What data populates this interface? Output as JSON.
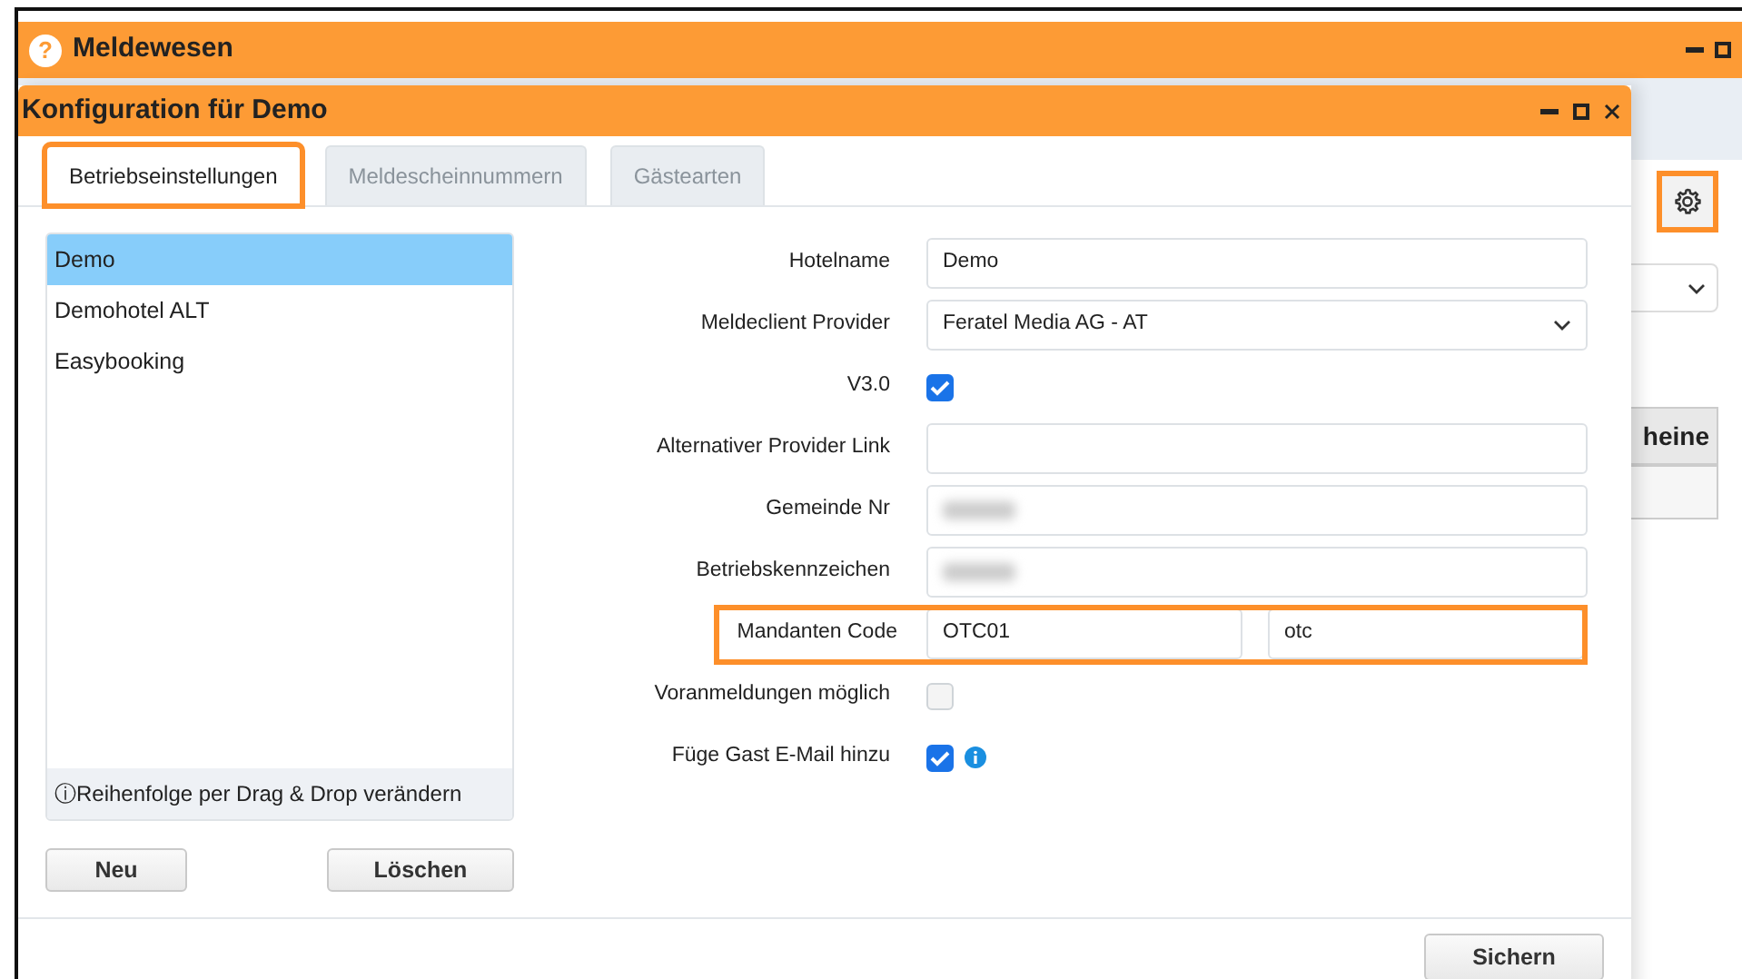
{
  "background_window": {
    "title": "Meldewesen",
    "help_icon": "?",
    "settings_button": {
      "highlighted": true
    },
    "table_header": "heine"
  },
  "dialog": {
    "title": "Konfiguration für Demo",
    "tabs": [
      {
        "label": "Betriebseinstellungen",
        "selected": true,
        "highlighted": true
      },
      {
        "label": "Meldescheinnummern",
        "selected": false,
        "highlighted": false
      },
      {
        "label": "Gästearten",
        "selected": false,
        "highlighted": false
      }
    ],
    "list": {
      "items": [
        {
          "label": "Demo",
          "selected": true
        },
        {
          "label": "Demohotel ALT",
          "selected": false
        },
        {
          "label": "Easybooking",
          "selected": false
        }
      ],
      "hint": "ⓘReihenfolge per Drag & Drop verändern"
    },
    "buttons": [
      "Neu",
      "Löschen"
    ],
    "form": [
      {
        "kind": "text",
        "label": "Hotelname",
        "value": "Demo"
      },
      {
        "kind": "select",
        "label": "Meldeclient Provider",
        "value": "Feratel Media AG - AT"
      },
      {
        "kind": "checkbox",
        "label": "V3.0",
        "checked": true
      },
      {
        "kind": "text",
        "label": "Alternativer Provider Link"
      },
      {
        "kind": "text",
        "label": "Gemeinde Nr",
        "redacted": true
      },
      {
        "kind": "text",
        "label": "Betriebskennzeichen",
        "redacted": true
      },
      {
        "kind": "pair",
        "label": "Mandanten Code",
        "values": [
          "OTC01",
          "otc"
        ],
        "highlighted": true
      },
      {
        "kind": "checkbox",
        "label": "Voranmeldungen möglich",
        "checked": false
      },
      {
        "kind": "checkbox",
        "label": "Füge Gast E-Mail hinzu",
        "checked": true,
        "info": true
      }
    ],
    "save_button": "Sichern"
  }
}
